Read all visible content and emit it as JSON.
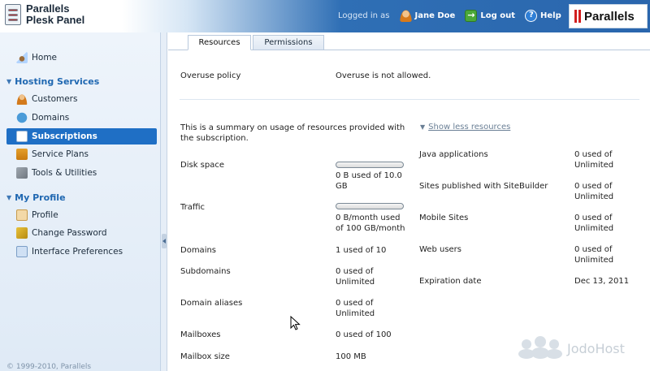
{
  "header": {
    "app_title_line1": "Parallels",
    "app_title_line2": "Plesk Panel",
    "logged_in_as": "Logged in as",
    "user_name": "Jane Doe",
    "logout_label": "Log out",
    "help_label": "Help",
    "brand": "Parallels"
  },
  "sidebar": {
    "home": "Home",
    "hosting_services": "Hosting Services",
    "customers": "Customers",
    "domains": "Domains",
    "subscriptions": "Subscriptions",
    "service_plans": "Service Plans",
    "tools": "Tools & Utilities",
    "my_profile": "My Profile",
    "profile": "Profile",
    "change_password": "Change Password",
    "interface_preferences": "Interface Preferences",
    "copyright": "© 1999-2010, Parallels"
  },
  "tabs": {
    "resources": "Resources",
    "permissions": "Permissions"
  },
  "main": {
    "overuse_label": "Overuse policy",
    "overuse_value": "Overuse is not allowed.",
    "summary": "This is a summary on usage of resources provided with the subscription.",
    "show_less": "Show less resources",
    "left_rows": [
      {
        "label": "Disk space",
        "value": "0 B used of 10.0 GB",
        "usage": 0
      },
      {
        "label": "Traffic",
        "value": "0 B/month used of 100 GB/month",
        "usage": 0
      },
      {
        "label": "Domains",
        "value": "1 used of 10"
      },
      {
        "label": "Subdomains",
        "value": "0 used of Unlimited"
      },
      {
        "label": "Domain aliases",
        "value": "0 used of Unlimited"
      },
      {
        "label": "Mailboxes",
        "value": "0 used of 100"
      },
      {
        "label": "Mailbox size",
        "value": "100 MB"
      }
    ],
    "right_rows": [
      {
        "label": "Java applications",
        "value": "0 used of Unlimited"
      },
      {
        "label": "Sites published with SiteBuilder",
        "value": "0 used of Unlimited"
      },
      {
        "label": "Mobile Sites",
        "value": "0 used of Unlimited"
      },
      {
        "label": "Web users",
        "value": "0 used of Unlimited"
      },
      {
        "label": "Expiration date",
        "value": "Dec 13, 2011"
      }
    ]
  },
  "watermark": "JodoHost",
  "icons": {
    "logo": "plesk-logo-icon",
    "user": "user-icon",
    "logout": "logout-icon",
    "help": "help-icon"
  }
}
